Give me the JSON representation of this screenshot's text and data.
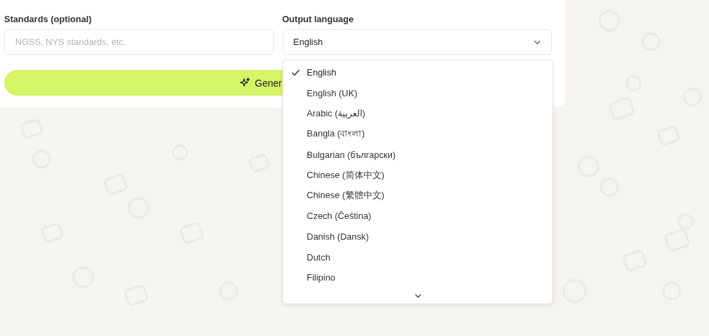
{
  "standards": {
    "label": "Standards (optional)",
    "placeholder": "NGSS, NYS standards, etc."
  },
  "output_language": {
    "label": "Output language",
    "value": "English",
    "expanded": true,
    "options": [
      {
        "label": "English",
        "selected": true
      },
      {
        "label": "English (UK)",
        "selected": false
      },
      {
        "label": "Arabic (العربية)",
        "selected": false
      },
      {
        "label": "Bangla (বাংলা)",
        "selected": false
      },
      {
        "label": "Bulgarian (български)",
        "selected": false
      },
      {
        "label": "Chinese (简体中文)",
        "selected": false
      },
      {
        "label": "Chinese (繁體中文)",
        "selected": false
      },
      {
        "label": "Czech (Čeština)",
        "selected": false
      },
      {
        "label": "Danish (Dansk)",
        "selected": false
      },
      {
        "label": "Dutch",
        "selected": false
      },
      {
        "label": "Filipino",
        "selected": false
      }
    ]
  },
  "generate_button": {
    "label": "Gener"
  }
}
